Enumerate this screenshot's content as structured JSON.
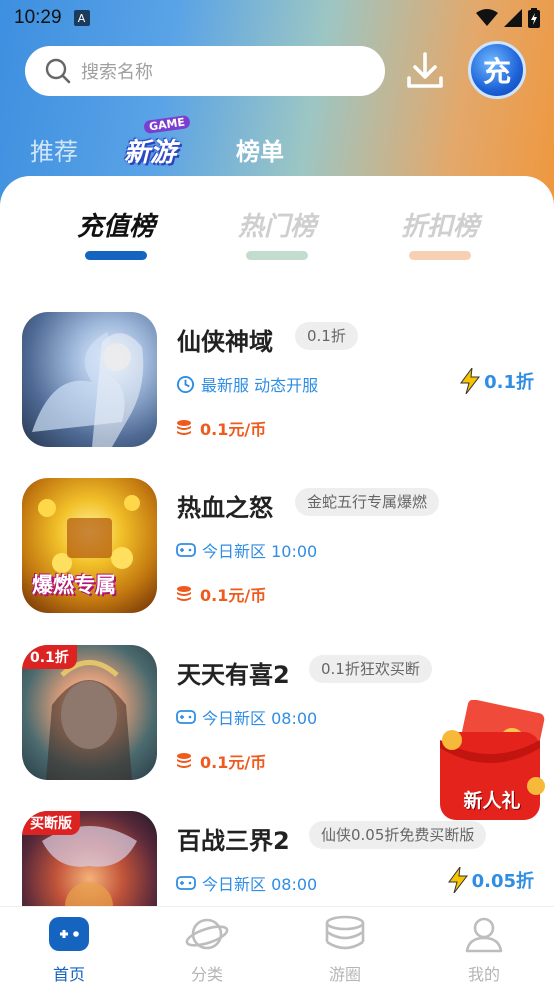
{
  "status_bar": {
    "time": "10:29",
    "app_badge": "A"
  },
  "search": {
    "placeholder": "搜索名称"
  },
  "charge_button": {
    "label": "充"
  },
  "category_tabs": {
    "recommend": "推荐",
    "new_game_logo_top": "GAME",
    "new_game_logo": "新游",
    "ranking": "榜单"
  },
  "rank_tabs": [
    {
      "label": "充值榜",
      "active": true
    },
    {
      "label": "热门榜",
      "active": false
    },
    {
      "label": "折扣榜",
      "active": false
    }
  ],
  "games": [
    {
      "name": "仙侠神域",
      "badge": "0.1折",
      "info": "最新服 动态开服",
      "info_icon": "clock-icon",
      "price": "0.1元/币",
      "discount": "0.1折",
      "thumb_tag": "",
      "thumb_banner": ""
    },
    {
      "name": "热血之怒",
      "badge": "金蛇五行专属爆燃",
      "info": "今日新区 10:00",
      "info_icon": "gamepad-icon",
      "price": "0.1元/币",
      "discount": "",
      "thumb_tag": "",
      "thumb_banner": "爆燃专属"
    },
    {
      "name": "天天有喜2",
      "badge": "0.1折狂欢买断",
      "info": "今日新区 08:00",
      "info_icon": "gamepad-icon",
      "price": "0.1元/币",
      "discount": "",
      "thumb_tag": "0.1折",
      "thumb_banner": ""
    },
    {
      "name": "百战三界2",
      "badge": "仙侠0.05折免费买断版",
      "info": "今日新区 08:00",
      "info_icon": "gamepad-icon",
      "price": "",
      "discount": "0.05折",
      "thumb_tag": "买断版",
      "thumb_banner": ""
    }
  ],
  "red_packet": {
    "label": "新人礼"
  },
  "tabbar": [
    {
      "label": "首页",
      "icon": "gamepad-icon",
      "active": true
    },
    {
      "label": "分类",
      "icon": "planet-icon",
      "active": false
    },
    {
      "label": "游圈",
      "icon": "stack-icon",
      "active": false
    },
    {
      "label": "我的",
      "icon": "user-icon",
      "active": false
    }
  ],
  "colors": {
    "accent": "#1565c0",
    "link": "#2f8de4",
    "price": "#ef5a1e"
  }
}
